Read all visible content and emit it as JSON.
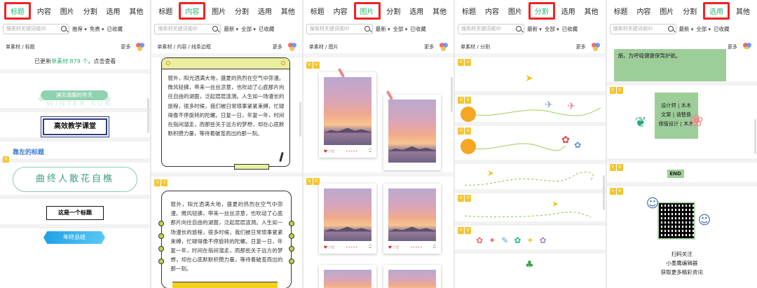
{
  "tabs_common": [
    "标题",
    "内容",
    "图片",
    "分割",
    "选用",
    "其他"
  ],
  "search_placeholder": "搜索材关键词或ID",
  "filters": {
    "p1": [
      "推荐",
      "免费",
      "已收藏"
    ],
    "p2": [
      "最新",
      "全部",
      "已收藏"
    ],
    "p3": [
      "最新",
      "全部",
      "已收藏"
    ],
    "p4": [
      "最新",
      "全部",
      "已收藏"
    ],
    "p5": [
      "最新",
      "全部",
      "已收藏"
    ]
  },
  "crumbs": {
    "p1": "单素材 / 标题",
    "p2": "单素材 / 内容 / 线条边框",
    "p3": "单素材 / 图片",
    "p4": "单素材 / 分割",
    "p5": ""
  },
  "more": "更多",
  "active_tab": {
    "p1": "标题",
    "p2": "内容",
    "p3": "图片",
    "p4": "分割",
    "p5": "选用"
  },
  "p1": {
    "update_pre": "已更新",
    "update_link": "单素材 879 个",
    "update_post": "，点击查看",
    "t1": "遇见温暖的冬天",
    "t1_sub": "WINTER SUN",
    "t2": "高效教学课堂",
    "t3": "靠左的标题",
    "t4": "曲终人散花自樵",
    "t5": "这是一个标题",
    "t6": "年终总结"
  },
  "p2": {
    "para": "窗外，阳光洒满大地，盛夏的热烈在空气中弥漫。微风轻拂，带来一丝丝凉意，也吹动了心底那片向往自由的湖面，泛起层层涟漪。人生如一场漫长的旅程，很多时候，我们被日常琐事紧紧束缚，忙碌得像不停旋转的陀螺。日复一日，年复一年，时间在指间溜走，而那些关于远方的梦想，却在心底默默积攒力量，等待着破茧而出的那一刻。"
  },
  "p5": {
    "top_text": "施，为呼吸健康保驾护航。",
    "credits": [
      "设计师 | 木木",
      "文案 | 请替换",
      "排版设计 | 木木"
    ],
    "end": "END",
    "qr_lines": [
      "扫码关注",
      "小墨鹰编辑器",
      "获取更多精彩资讯"
    ]
  },
  "colors": {
    "accent": "#2bb673",
    "highlight": "#e22222",
    "yellow": "#f4c531",
    "green_block": "#9dce9a"
  }
}
